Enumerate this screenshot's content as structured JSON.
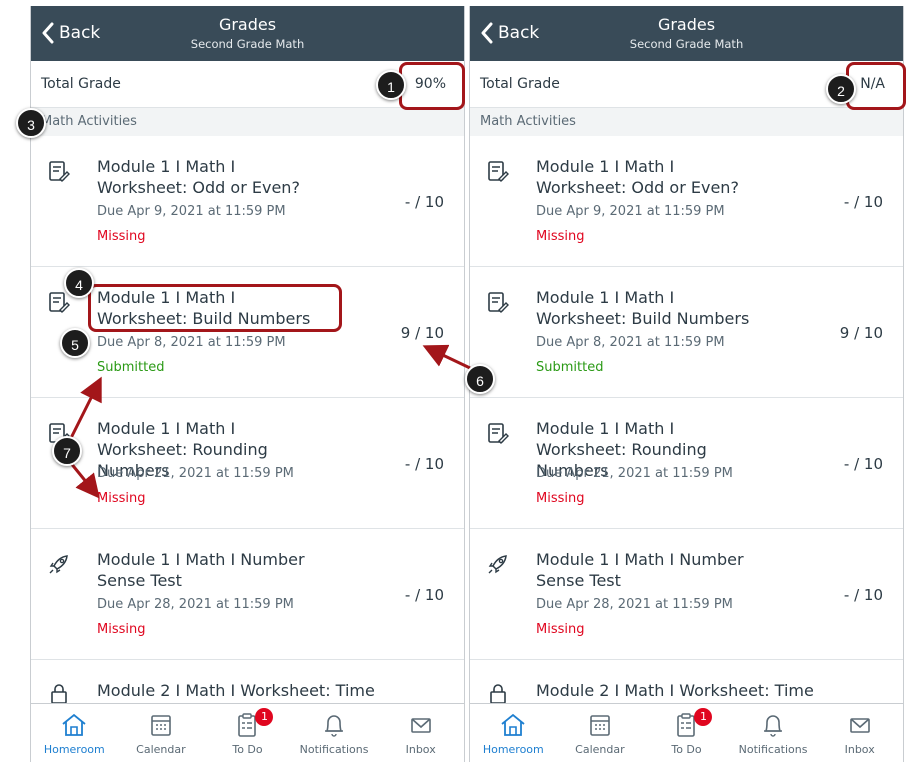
{
  "screens": [
    {
      "back_label": "Back",
      "title": "Grades",
      "subtitle": "Second Grade Math",
      "total_label": "Total Grade",
      "total_value": "90%",
      "section_label": "Math Activities",
      "rows": [
        {
          "title": "Module 1 I Math I Worksheet: Odd or Even?",
          "due": "Due Apr 9, 2021 at 11:59 PM",
          "status": "Missing",
          "score": "- / 10"
        },
        {
          "title": "Module 1 I Math I Worksheet: Build Numbers",
          "due": "Due Apr 8, 2021 at 11:59 PM",
          "status": "Submitted",
          "score": "9 / 10"
        },
        {
          "title": "Module 1 I Math I Worksheet: Rounding Numbers",
          "due": "Due Apr 21, 2021 at 11:59 PM",
          "status": "Missing",
          "score": "- / 10"
        },
        {
          "title": "Module 1 I Math I Number Sense Test",
          "due": "Due Apr 28, 2021 at 11:59 PM",
          "status": "Missing",
          "score": "- / 10"
        },
        {
          "title": "Module 2 I Math I Worksheet: Time",
          "due": "",
          "status": "",
          "score": ""
        }
      ],
      "tabs": [
        "Homeroom",
        "Calendar",
        "To Do",
        "Notifications",
        "Inbox"
      ],
      "todo_badge": "1"
    },
    {
      "back_label": "Back",
      "title": "Grades",
      "subtitle": "Second Grade Math",
      "total_label": "Total Grade",
      "total_value": "N/A",
      "section_label": "Math Activities",
      "rows": [
        {
          "title": "Module 1 I Math I Worksheet: Odd or Even?",
          "due": "Due Apr 9, 2021 at 11:59 PM",
          "status": "Missing",
          "score": "- / 10"
        },
        {
          "title": "Module 1 I Math I Worksheet: Build Numbers",
          "due": "Due Apr 8, 2021 at 11:59 PM",
          "status": "Submitted",
          "score": "9 / 10"
        },
        {
          "title": "Module 1 I Math I Worksheet: Rounding Numbers",
          "due": "Due Apr 21, 2021 at 11:59 PM",
          "status": "Missing",
          "score": "- / 10"
        },
        {
          "title": "Module 1 I Math I Number Sense Test",
          "due": "Due Apr 28, 2021 at 11:59 PM",
          "status": "Missing",
          "score": "- / 10"
        },
        {
          "title": "Module 2 I Math I Worksheet: Time",
          "due": "",
          "status": "",
          "score": ""
        }
      ],
      "tabs": [
        "Homeroom",
        "Calendar",
        "To Do",
        "Notifications",
        "Inbox"
      ],
      "todo_badge": "1"
    }
  ],
  "callouts": [
    "1",
    "2",
    "3",
    "4",
    "5",
    "6",
    "7"
  ],
  "colors": {
    "header": "#394b58",
    "missing": "#e0061f",
    "submitted": "#2b9a16",
    "active_tab": "#1e7fd0",
    "callout_highlight": "#a3161a"
  }
}
